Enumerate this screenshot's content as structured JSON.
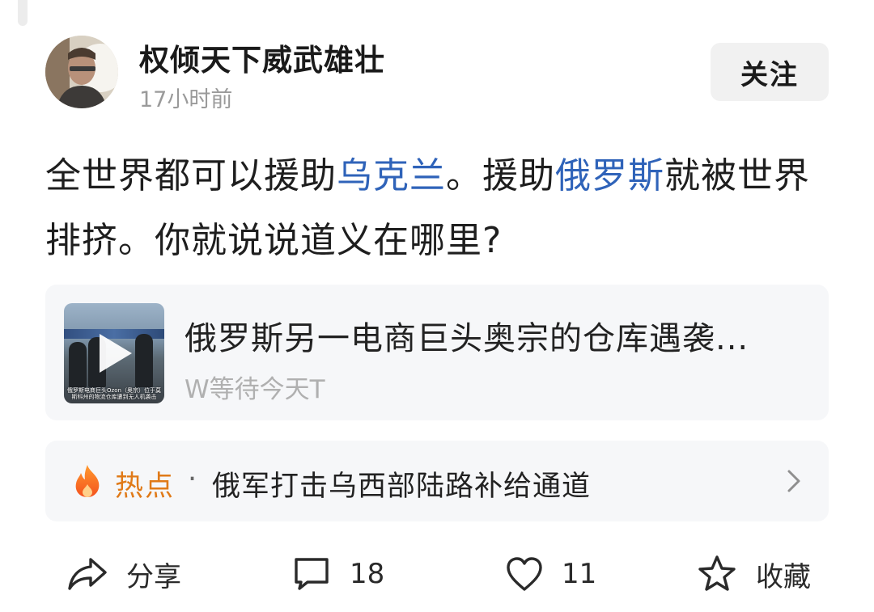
{
  "author": {
    "name": "权倾天下威武雄壮",
    "time": "17小时前"
  },
  "follow_button": {
    "label": "关注"
  },
  "post": {
    "segments": [
      {
        "text": "全世界都可以援助",
        "link": false
      },
      {
        "text": "乌克兰",
        "link": true
      },
      {
        "text": "。援助",
        "link": false
      },
      {
        "text": "俄罗斯",
        "link": true
      },
      {
        "text": "就被世界排挤。你就说说道义在哪里?",
        "link": false
      }
    ]
  },
  "video_card": {
    "title": "俄罗斯另一电商巨头奥宗的仓库遇袭...",
    "author": "W等待今天T",
    "thumbnail_caption": "俄罗斯电商巨头Ozon（奥宗）位于莫斯科州的物流仓库遭到无人机袭击"
  },
  "hot_topic": {
    "label": "热点",
    "separator": "·",
    "title": "俄军打击乌西部陆路补给通道"
  },
  "actions": {
    "share_label": "分享",
    "comment_count": "18",
    "like_count": "11",
    "collect_label": "收藏"
  },
  "colors": {
    "link": "#2f63b9",
    "hot": "#e07a18",
    "card_bg": "#f6f7f9"
  },
  "icons": {
    "share": "share-icon",
    "comment": "comment-icon",
    "like": "heart-icon",
    "collect": "star-icon",
    "hot": "flame-icon",
    "play": "play-icon",
    "chevron": "chevron-right-icon"
  }
}
